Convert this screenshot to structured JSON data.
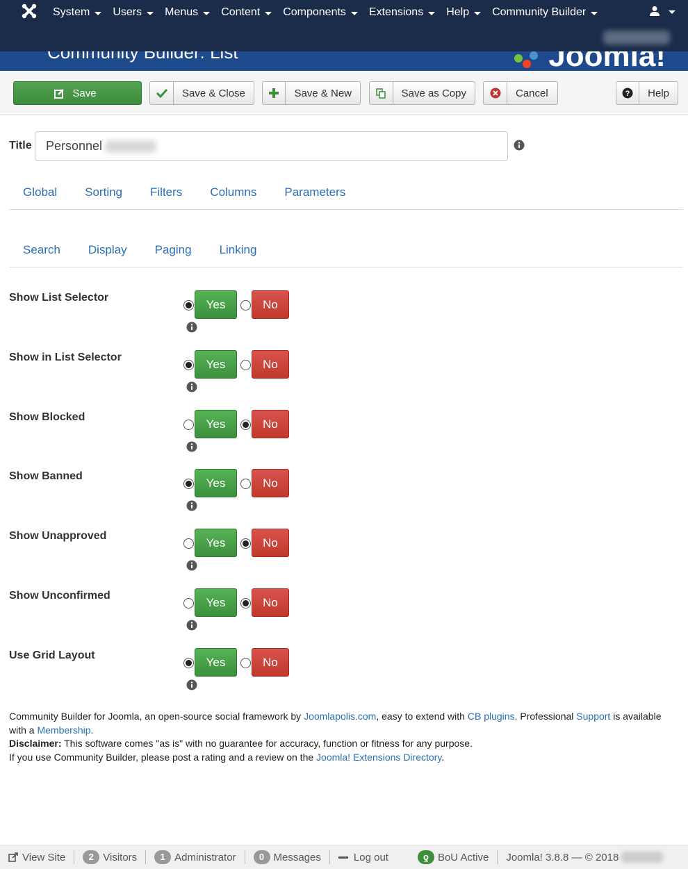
{
  "nav": {
    "menu": [
      "System",
      "Users",
      "Menus",
      "Content",
      "Components",
      "Extensions",
      "Help",
      "Community Builder"
    ]
  },
  "header": {
    "page_title": "Community Builder: List",
    "brand": "Joomla!"
  },
  "toolbar": {
    "save": "Save",
    "save_close": "Save & Close",
    "save_new": "Save & New",
    "save_copy": "Save as Copy",
    "cancel": "Cancel",
    "help": "Help"
  },
  "form": {
    "title_label": "Title",
    "title_value": "Personnel"
  },
  "tabs_primary": [
    "Global",
    "Sorting",
    "Filters",
    "Columns",
    "Parameters"
  ],
  "tabs_secondary": [
    "Search",
    "Display",
    "Paging",
    "Linking"
  ],
  "options": [
    {
      "label": "Show List Selector",
      "yes": "Yes",
      "no": "No",
      "selected": "yes"
    },
    {
      "label": "Show in List Selector",
      "yes": "Yes",
      "no": "No",
      "selected": "yes"
    },
    {
      "label": "Show Blocked",
      "yes": "Yes",
      "no": "No",
      "selected": "no"
    },
    {
      "label": "Show Banned",
      "yes": "Yes",
      "no": "No",
      "selected": "yes"
    },
    {
      "label": "Show Unapproved",
      "yes": "Yes",
      "no": "No",
      "selected": "no"
    },
    {
      "label": "Show Unconfirmed",
      "yes": "Yes",
      "no": "No",
      "selected": "no"
    },
    {
      "label": "Use Grid Layout",
      "yes": "Yes",
      "no": "No",
      "selected": "yes"
    }
  ],
  "footer": {
    "l1_a": "Community Builder for Joomla, an open-source social framework by ",
    "l1_link1": "Joomlapolis.com",
    "l1_b": ", easy to extend with ",
    "l1_link2": "CB plugins",
    "l1_c": ". Professional ",
    "l1_link3": "Support",
    "l1_d": " is available with a ",
    "l1_link4": "Membership",
    "l1_e": ".",
    "disclaimer_label": "Disclaimer:",
    "disclaimer_text": " This software comes \"as is\" with no guarantee for accuracy, function or fitness for any purpose.",
    "l3_a": "If you use Community Builder, please post a rating and a review on the ",
    "l3_link": "Joomla! Extensions Directory",
    "l3_b": "."
  },
  "statusbar": {
    "view_site": "View Site",
    "visitors_count": "2",
    "visitors": "Visitors",
    "admin_count": "1",
    "admin": "Administrator",
    "messages_count": "0",
    "messages": "Messages",
    "logout": "Log out",
    "bou": "BoU Active",
    "version": "Joomla! 3.8.8",
    "copyright": "— © 2018"
  },
  "colors": {
    "nav_bg": "#1a2c4a",
    "title_bg": "#1e4a8c",
    "yes_green": "#46a546",
    "no_red": "#cf3e35",
    "link_blue": "#2a6fb5"
  }
}
